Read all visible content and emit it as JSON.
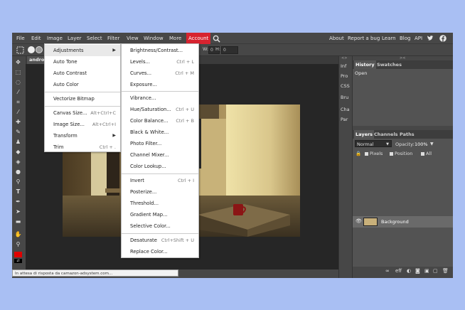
{
  "menubar": {
    "items": [
      "File",
      "Edit",
      "Image",
      "Layer",
      "Select",
      "Filter",
      "View",
      "Window",
      "More",
      "Account"
    ],
    "right": [
      "About",
      "Report a bug",
      "Learn",
      "Blog",
      "API"
    ]
  },
  "options_bar": {
    "w_label": "W:",
    "w_value": "0",
    "h_label": "H:",
    "h_value": "0"
  },
  "document": {
    "tab_label": "androi"
  },
  "image_menu": {
    "items": [
      {
        "label": "Adjustments",
        "shortcut": ""
      },
      {
        "label": "Auto Tone",
        "shortcut": ""
      },
      {
        "label": "Auto Contrast",
        "shortcut": ""
      },
      {
        "label": "Auto Color",
        "shortcut": ""
      },
      {
        "label": "Vectorize Bitmap",
        "shortcut": ""
      },
      {
        "label": "Canvas Size...",
        "shortcut": "Alt+Ctrl+C"
      },
      {
        "label": "Image Size...",
        "shortcut": "Alt+Ctrl+I"
      },
      {
        "label": "Transform",
        "shortcut": ""
      },
      {
        "label": "Trim",
        "shortcut": "Ctrl + ."
      }
    ]
  },
  "adjust_menu": {
    "items": [
      {
        "label": "Brightness/Contrast...",
        "shortcut": ""
      },
      {
        "label": "Levels...",
        "shortcut": "Ctrl + L"
      },
      {
        "label": "Curves...",
        "shortcut": "Ctrl + M"
      },
      {
        "label": "Exposure...",
        "shortcut": ""
      },
      {
        "label": "Vibrance...",
        "shortcut": ""
      },
      {
        "label": "Hue/Saturation...",
        "shortcut": "Ctrl + U"
      },
      {
        "label": "Color Balance...",
        "shortcut": "Ctrl + B"
      },
      {
        "label": "Black & White...",
        "shortcut": ""
      },
      {
        "label": "Photo Filter...",
        "shortcut": ""
      },
      {
        "label": "Channel Mixer...",
        "shortcut": ""
      },
      {
        "label": "Color Lookup...",
        "shortcut": ""
      },
      {
        "label": "Invert",
        "shortcut": "Ctrl + I"
      },
      {
        "label": "Posterize...",
        "shortcut": ""
      },
      {
        "label": "Threshold...",
        "shortcut": ""
      },
      {
        "label": "Gradient Map...",
        "shortcut": ""
      },
      {
        "label": "Selective Color...",
        "shortcut": ""
      },
      {
        "label": "Desaturate",
        "shortcut": "Ctrl+Shift + U"
      },
      {
        "label": "Replace Color...",
        "shortcut": ""
      }
    ]
  },
  "mini_tabs": [
    "Inf",
    "Pro",
    "CSS",
    "Bru",
    "Cha",
    "Par"
  ],
  "history_panel": {
    "tabs": [
      "History",
      "Swatches"
    ],
    "items": [
      "Open"
    ]
  },
  "layers_panel": {
    "tabs": [
      "Layers",
      "Channels",
      "Paths"
    ],
    "blend_mode": "Normal",
    "opacity_label": "Opacity:",
    "opacity_value": "100%",
    "lock_options": [
      "Pixels",
      "Position",
      "All"
    ],
    "layers": [
      {
        "name": "Background"
      }
    ]
  },
  "status_bar": {
    "text": "In attesa di risposta da camazon-adsystem.com..."
  },
  "colors": {
    "accent": "#d7232f",
    "fg_swatch": "#e00000",
    "bg_swatch": "#000000"
  }
}
